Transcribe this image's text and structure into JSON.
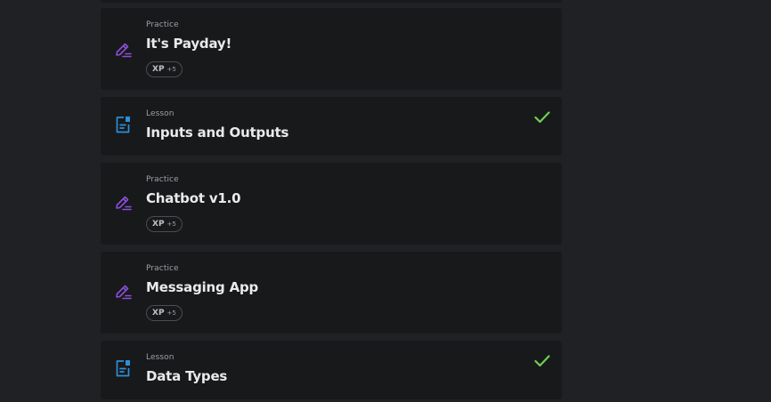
{
  "items": [
    {
      "type": "Practice",
      "title": "It's Payday!",
      "xp_label": "XP",
      "xp_amount": "+5",
      "completed": false,
      "icon": "pencil-icon"
    },
    {
      "type": "Lesson",
      "title": "Inputs and Outputs",
      "completed": true,
      "icon": "document-icon"
    },
    {
      "type": "Practice",
      "title": "Chatbot v1.0",
      "xp_label": "XP",
      "xp_amount": "+5",
      "completed": false,
      "icon": "pencil-icon"
    },
    {
      "type": "Practice",
      "title": "Messaging App",
      "xp_label": "XP",
      "xp_amount": "+5",
      "completed": false,
      "icon": "pencil-icon"
    },
    {
      "type": "Lesson",
      "title": "Data Types",
      "completed": true,
      "icon": "document-icon"
    }
  ],
  "colors": {
    "background": "#202124",
    "card": "#18191b",
    "practice_icon": "#8a4fd8",
    "lesson_icon": "#2d8fd6",
    "check": "#6fd04f"
  }
}
